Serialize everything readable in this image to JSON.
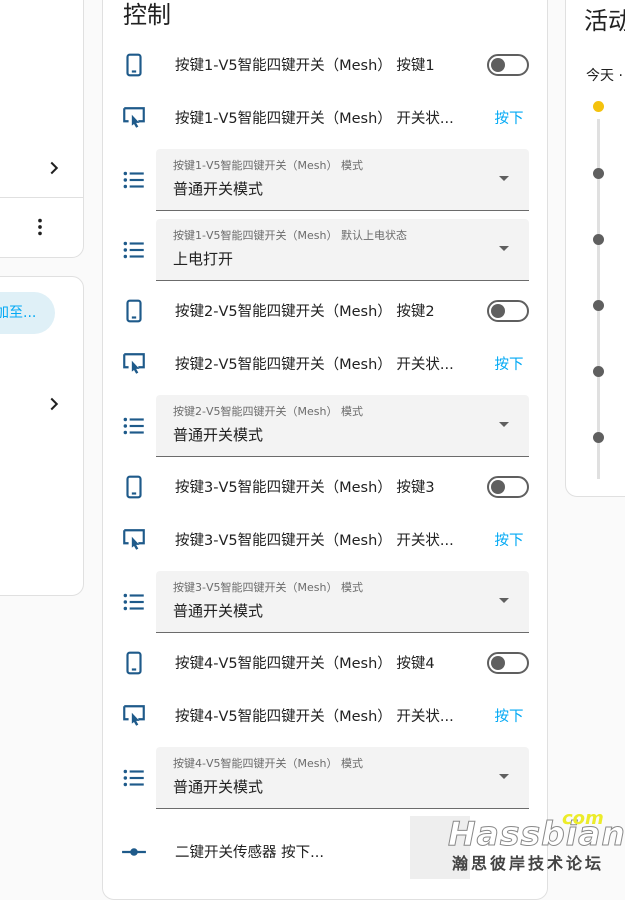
{
  "left": {
    "pill_text": "添加至..."
  },
  "main": {
    "title": "控制",
    "rows": [
      {
        "kind": "toggle",
        "label": "按键1-V5智能四键开关（Mesh） 按键1"
      },
      {
        "kind": "press",
        "label": "按键1-V5智能四键开关（Mesh） 开关状...",
        "action": "按下"
      },
      {
        "kind": "select",
        "label": "按键1-V5智能四键开关（Mesh） 模式",
        "value": "普通开关模式"
      },
      {
        "kind": "select",
        "label": "按键1-V5智能四键开关（Mesh） 默认上电状态",
        "value": "上电打开"
      },
      {
        "kind": "toggle",
        "label": "按键2-V5智能四键开关（Mesh） 按键2"
      },
      {
        "kind": "press",
        "label": "按键2-V5智能四键开关（Mesh） 开关状...",
        "action": "按下"
      },
      {
        "kind": "select",
        "label": "按键2-V5智能四键开关（Mesh） 模式",
        "value": "普通开关模式"
      },
      {
        "kind": "toggle",
        "label": "按键3-V5智能四键开关（Mesh） 按键3"
      },
      {
        "kind": "press",
        "label": "按键3-V5智能四键开关（Mesh） 开关状...",
        "action": "按下"
      },
      {
        "kind": "select",
        "label": "按键3-V5智能四键开关（Mesh） 模式",
        "value": "普通开关模式"
      },
      {
        "kind": "toggle",
        "label": "按键4-V5智能四键开关（Mesh） 按键4"
      },
      {
        "kind": "press",
        "label": "按键4-V5智能四键开关（Mesh） 开关状...",
        "action": "按下"
      },
      {
        "kind": "select",
        "label": "按键4-V5智能四键开关（Mesh） 模式",
        "value": "普通开关模式"
      },
      {
        "kind": "sensor",
        "label": "二键开关传感器 按下..."
      }
    ]
  },
  "right": {
    "title": "活动",
    "today": "今天 ·"
  },
  "watermark": {
    "brand": "Hassbian",
    "com": "com",
    "sub": "瀚思彼岸技术论坛"
  },
  "colors": {
    "accent": "#03a9f4",
    "icon": "#1e5a8a",
    "timeline_first": "#f4c20d",
    "timeline_dot": "#5f5f5f"
  },
  "icons": {
    "toggle_row": "cellphone-icon",
    "press_row": "gesture-tap-icon",
    "select_row": "format-list-bulleted-icon",
    "sensor_row": "commit-icon"
  }
}
